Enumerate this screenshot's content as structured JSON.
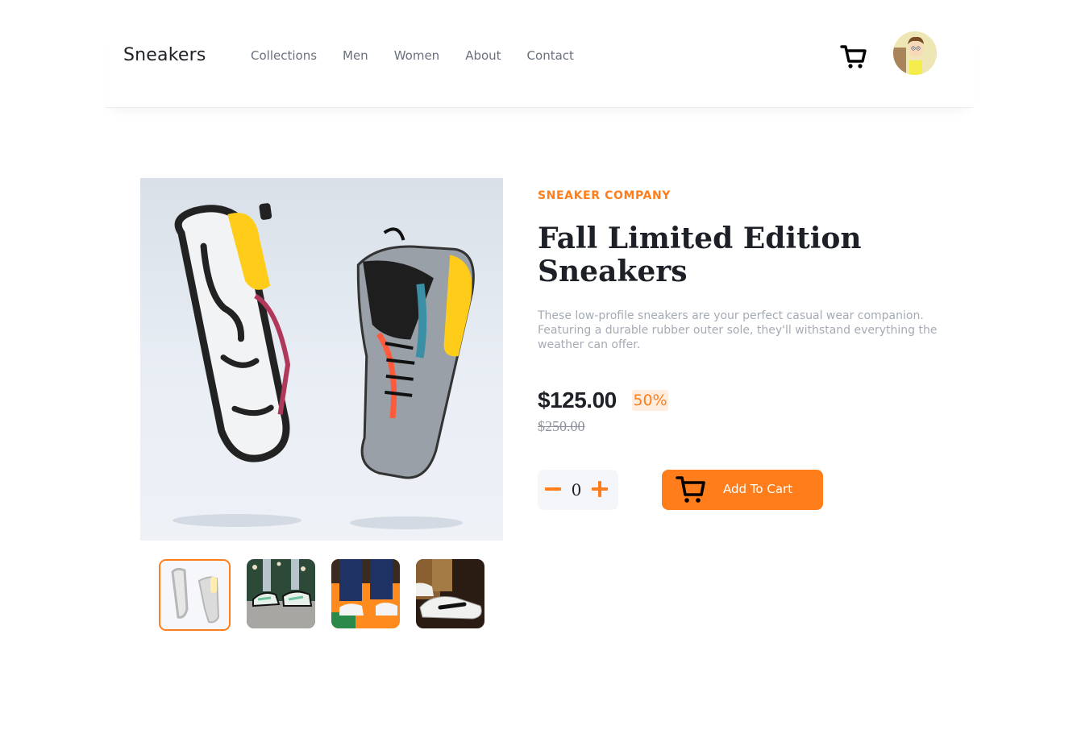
{
  "header": {
    "logo": "Sneakers",
    "nav": [
      "Collections",
      "Men",
      "Women",
      "About",
      "Contact"
    ],
    "cart_icon": "cart-icon",
    "avatar_icon": "user-avatar"
  },
  "product": {
    "company": "SNEAKER COMPANY",
    "title": "Fall Limited Edition Sneakers",
    "description": "These low-profile sneakers are your perfect casual wear companion. Featuring a durable rubber outer sole, they'll withstand everything the weather can offer.",
    "price": "$125.00",
    "discount": "50%",
    "old_price": "$250.00",
    "quantity": "0",
    "add_to_cart": "Add To Cart"
  },
  "gallery": {
    "thumbnail_count": 4,
    "active_index": 0
  },
  "colors": {
    "accent": "#ff7e1b",
    "accent_light": "#ffede0",
    "text_dark": "#1d2026",
    "text_muted": "#69707d",
    "text_light": "#a5abb4"
  }
}
